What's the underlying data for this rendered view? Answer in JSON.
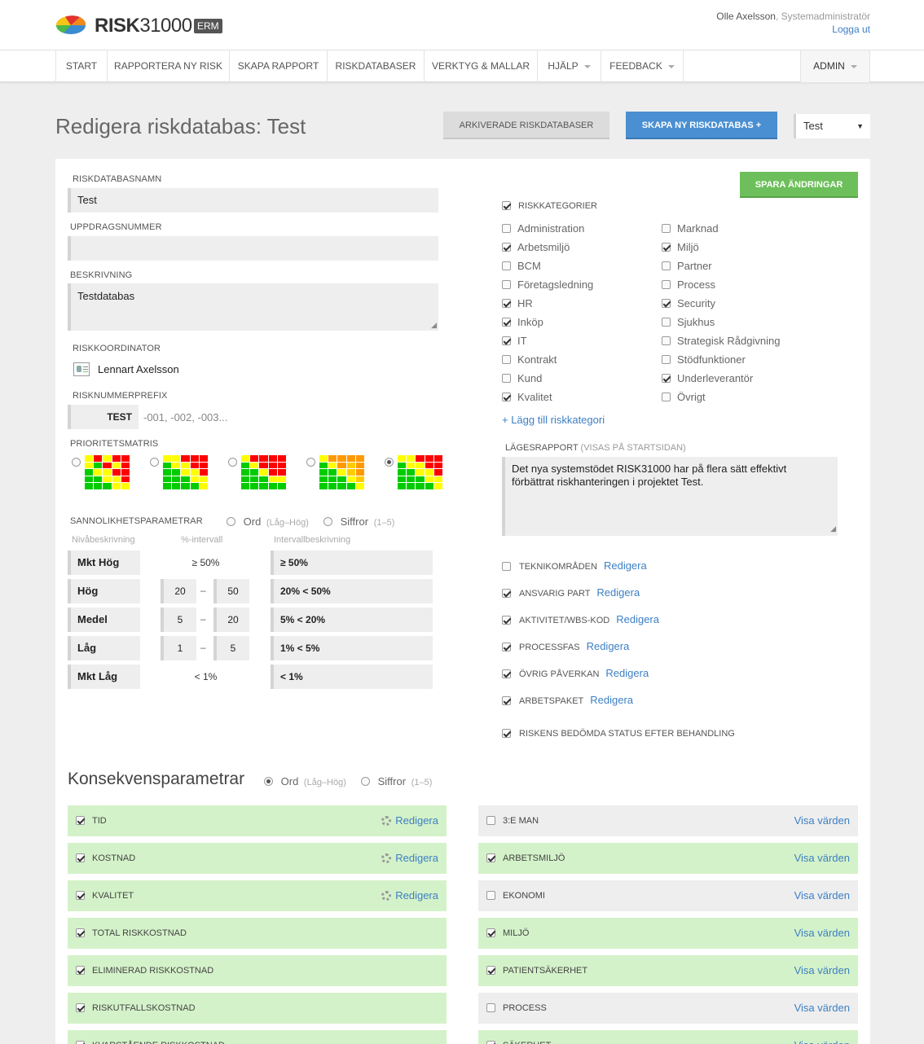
{
  "brand": {
    "name_bold": "RISK",
    "name_light": "31000",
    "badge": "ERM"
  },
  "user": {
    "name": "Olle Axelsson",
    "role": ", Systemadministratör",
    "logout": "Logga ut"
  },
  "nav": {
    "items": [
      "START",
      "RAPPORTERA NY RISK",
      "SKAPA RAPPORT",
      "RISKDATABASER",
      "VERKTYG & MALLAR",
      "HJÄLP",
      "FEEDBACK"
    ],
    "admin": "ADMIN"
  },
  "page": {
    "title": "Redigera riskdatabas: Test",
    "archived_btn": "ARKIVERADE RISKDATABASER",
    "create_btn": "SKAPA NY RISKDATABAS +",
    "db_select": "Test",
    "save_btn": "SPARA ÄNDRINGAR"
  },
  "form": {
    "name_label": "RISKDATABASNAMN",
    "name_value": "Test",
    "assignment_label": "UPPDRAGSNUMMER",
    "assignment_value": "",
    "desc_label": "BESKRIVNING",
    "desc_value": "Testdatabas",
    "coordinator_label": "RISKKOORDINATOR",
    "coordinator_value": "Lennart Axelsson",
    "prefix_label": "RISKNUMMERPREFIX",
    "prefix_value": "TEST",
    "prefix_hint": "-001, -002, -003...",
    "matrix_label": "PRIORITETSMATRIS",
    "matrix_selected_index": 4
  },
  "colors": {
    "red": "#ff0000",
    "yellow": "#ffff00",
    "green": "#00cc00",
    "orange": "#ff9900",
    "lightorange": "#ffcc00",
    "button_blue": "#4a8fd1",
    "button_green": "#6cbf5a",
    "button_grey": "#dcdcdc"
  },
  "matrices": [
    [
      "wryrr",
      "ygryr",
      "gyyrr",
      "ggyyr",
      "gggyy"
    ],
    [
      "yyrrr",
      "gyyrr",
      "ggyyr",
      "gggyy",
      "ggggy"
    ],
    [
      "yrrrr",
      "gyrrr",
      "ggyrr",
      "gggyy",
      "ggggg"
    ],
    [
      "yoooo",
      "gyolo",
      "ggylo",
      "gggyl",
      "ggggy"
    ],
    [
      "wyrrr",
      "gwyrr",
      "ggwyr",
      "gggwy",
      "ggggw"
    ]
  ],
  "probability": {
    "label": "SANNOLIKHETSPARAMETRAR",
    "opt_words": "Ord",
    "opt_words_hint": "(Låg–Hög)",
    "opt_numbers": "Siffror",
    "opt_numbers_hint": "(1–5)",
    "col_level": "Nivåbeskrivning",
    "col_pct": "%-intervall",
    "col_interval": "Intervallbeskrivning",
    "rows": [
      {
        "level": "Mkt Hög",
        "single": "≥ 50%",
        "interval": "≥ 50%"
      },
      {
        "level": "Hög",
        "from": "20",
        "to": "50",
        "interval": "20% < 50%"
      },
      {
        "level": "Medel",
        "from": "5",
        "to": "20",
        "interval": "5% < 20%"
      },
      {
        "level": "Låg",
        "from": "1",
        "to": "5",
        "interval": "1% < 5%"
      },
      {
        "level": "Mkt Låg",
        "single": "< 1%",
        "interval": "< 1%"
      }
    ]
  },
  "categories": {
    "label": "RISKKATEGORIER",
    "add_link": "+ Lägg till riskkategori",
    "left": [
      {
        "name": "Administration",
        "checked": false
      },
      {
        "name": "Arbetsmiljö",
        "checked": true
      },
      {
        "name": "BCM",
        "checked": false
      },
      {
        "name": "Företagsledning",
        "checked": false
      },
      {
        "name": "HR",
        "checked": true
      },
      {
        "name": "Inköp",
        "checked": true
      },
      {
        "name": "IT",
        "checked": true
      },
      {
        "name": "Kontrakt",
        "checked": false
      },
      {
        "name": "Kund",
        "checked": false
      },
      {
        "name": "Kvalitet",
        "checked": true
      }
    ],
    "right": [
      {
        "name": "Marknad",
        "checked": false
      },
      {
        "name": "Miljö",
        "checked": true
      },
      {
        "name": "Partner",
        "checked": false
      },
      {
        "name": "Process",
        "checked": false
      },
      {
        "name": "Security",
        "checked": true
      },
      {
        "name": "Sjukhus",
        "checked": false
      },
      {
        "name": "Strategisk Rådgivning",
        "checked": false
      },
      {
        "name": "Stödfunktioner",
        "checked": false
      },
      {
        "name": "Underleverantör",
        "checked": true
      },
      {
        "name": "Övrigt",
        "checked": false
      }
    ]
  },
  "status_report": {
    "label": "LÄGESRAPPORT",
    "label_hint": "(VISAS PÅ STARTSIDAN)",
    "text": "Det nya systemstödet RISK31000 har på flera sätt effektivt förbättrat riskhanteringen i projektet Test."
  },
  "options": [
    {
      "name": "TEKNIKOMRÅDEN",
      "checked": false,
      "link": "Redigera"
    },
    {
      "name": "ANSVARIG PART",
      "checked": true,
      "link": "Redigera"
    },
    {
      "name": "AKTIVITET/WBS-KOD",
      "checked": true,
      "link": "Redigera"
    },
    {
      "name": "PROCESSFAS",
      "checked": true,
      "link": "Redigera"
    },
    {
      "name": "ÖVRIG PÅVERKAN",
      "checked": true,
      "link": "Redigera"
    },
    {
      "name": "ARBETSPAKET",
      "checked": true,
      "link": "Redigera"
    },
    {
      "name": "RISKENS BEDÖMDA STATUS EFTER BEHANDLING",
      "checked": true,
      "link": ""
    }
  ],
  "consequence": {
    "title": "Konsekvensparametrar",
    "opt_words": "Ord",
    "opt_words_hint": "(Låg–Hög)",
    "opt_numbers": "Siffror",
    "opt_numbers_hint": "(1–5)",
    "left": [
      {
        "name": "TID",
        "checked": true,
        "action": "Redigera",
        "gear": true
      },
      {
        "name": "KOSTNAD",
        "checked": true,
        "action": "Redigera",
        "gear": true
      },
      {
        "name": "KVALITET",
        "checked": true,
        "action": "Redigera",
        "gear": true
      },
      {
        "name": "TOTAL RISKKOSTNAD",
        "checked": true,
        "action": "",
        "gear": false
      },
      {
        "name": "ELIMINERAD RISKKOSTNAD",
        "checked": true,
        "action": "",
        "gear": false
      },
      {
        "name": "RISKUTFALLSKOSTNAD",
        "checked": true,
        "action": "",
        "gear": false
      },
      {
        "name": "KVARSTÅENDE RISKKOSTNAD",
        "checked": true,
        "action": "",
        "gear": false
      }
    ],
    "right": [
      {
        "name": "3:E MAN",
        "checked": false,
        "action": "Visa värden"
      },
      {
        "name": "ARBETSMILJÖ",
        "checked": true,
        "action": "Visa värden"
      },
      {
        "name": "EKONOMI",
        "checked": false,
        "action": "Visa värden"
      },
      {
        "name": "MILJÖ",
        "checked": true,
        "action": "Visa värden"
      },
      {
        "name": "PATIENTSÄKERHET",
        "checked": true,
        "action": "Visa värden"
      },
      {
        "name": "PROCESS",
        "checked": false,
        "action": "Visa värden"
      },
      {
        "name": "SÄKERHET",
        "checked": true,
        "action": "Visa värden"
      }
    ]
  }
}
